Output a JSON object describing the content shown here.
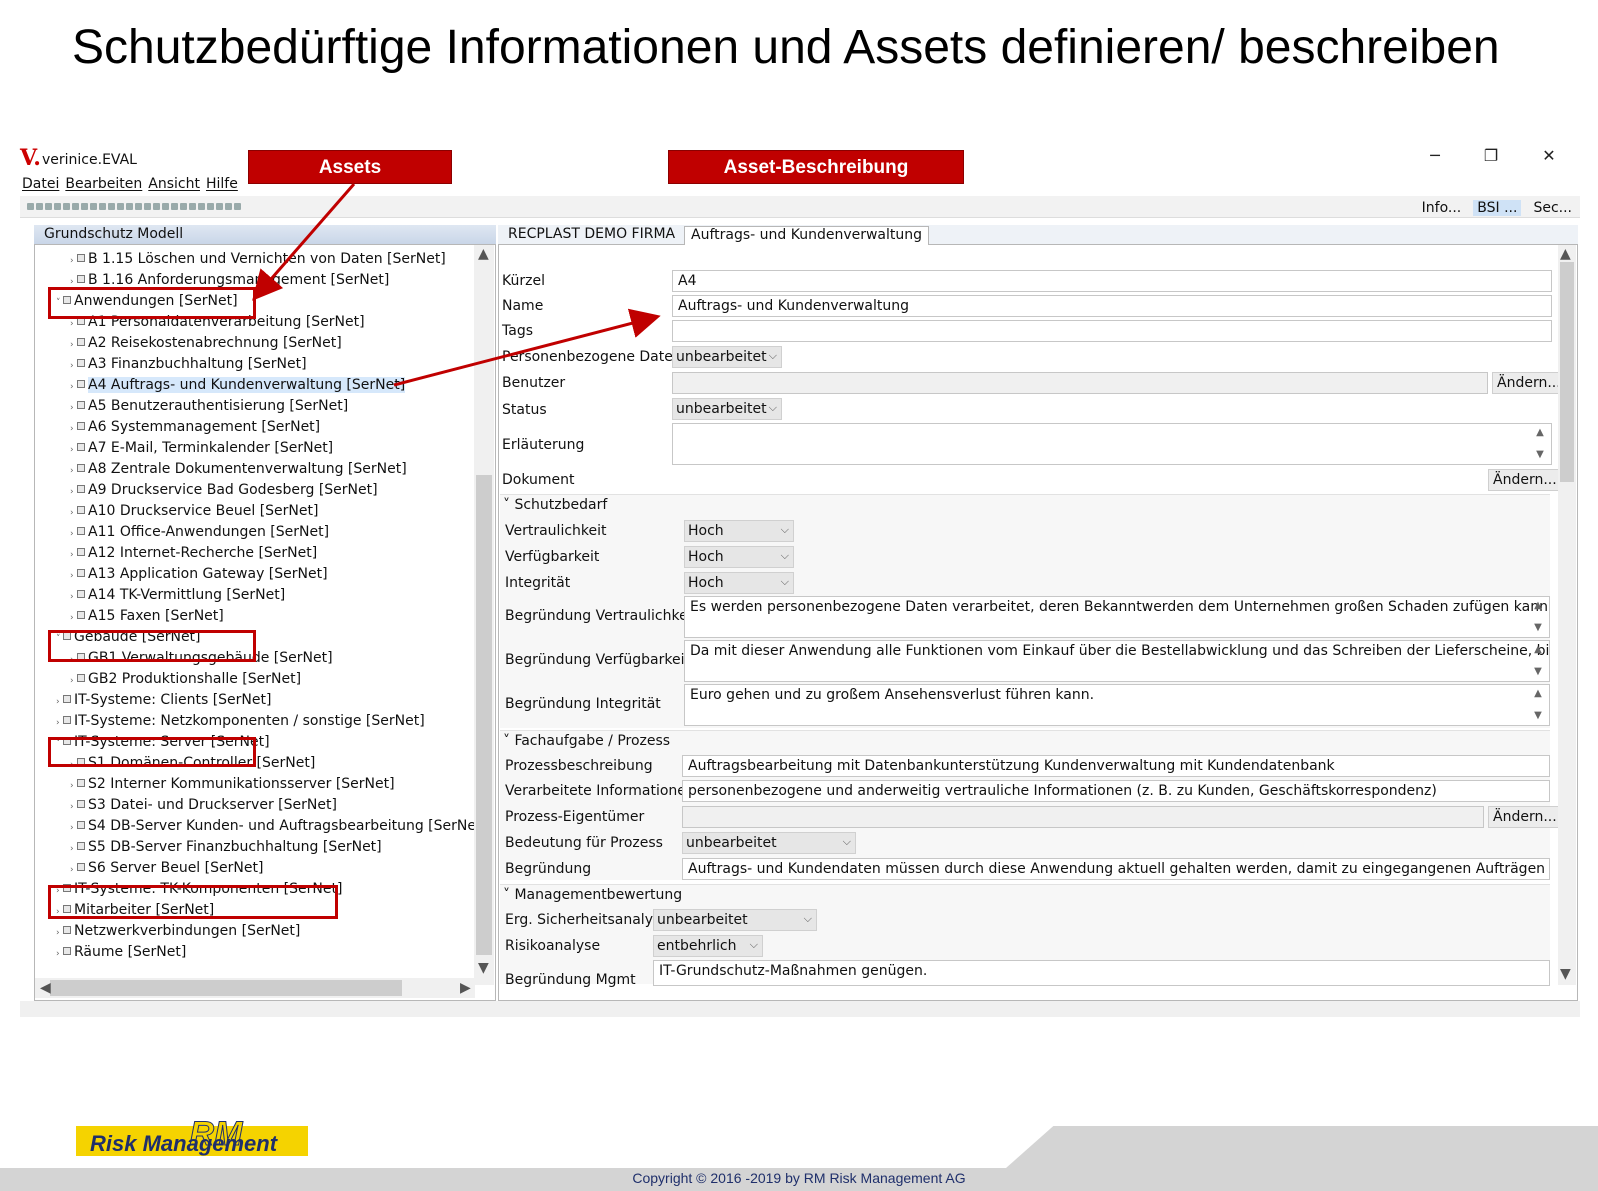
{
  "slide": {
    "title": "Schutzbedürftige Informationen und Assets definieren/ beschreiben",
    "label_assets": "Assets",
    "label_beschreibung": "Asset-Beschreibung",
    "copyright": "Copyright © 2016 -2019 by RM Risk Management AG",
    "logo_text": "Risk Management",
    "logo_mark": "RM"
  },
  "app": {
    "logo": "V.",
    "title": "verinice.EVAL",
    "menu": [
      "Datei",
      "Bearbeiten",
      "Ansicht",
      "Hilfe"
    ],
    "window_controls": {
      "minimize": "─",
      "restore": "❐",
      "close": "✕"
    },
    "perspectives": [
      {
        "label": "Info...",
        "active": false
      },
      {
        "label": "BSI ...",
        "active": true
      },
      {
        "label": "Sec...",
        "active": false
      }
    ]
  },
  "tree": {
    "title": "Grundschutz Modell",
    "items": [
      {
        "label": "B 1.15 Löschen und Vernichten von Daten [SerNet]",
        "level": 1
      },
      {
        "label": "B 1.16 Anforderungsmanagement [SerNet]",
        "level": 1
      },
      {
        "label": "Anwendungen [SerNet]",
        "level": 0,
        "expanded": true
      },
      {
        "label": "A1 Personaldatenverarbeitung [SerNet]",
        "level": 1
      },
      {
        "label": "A2 Reisekostenabrechnung [SerNet]",
        "level": 1
      },
      {
        "label": "A3 Finanzbuchhaltung [SerNet]",
        "level": 1
      },
      {
        "label": "A4 Auftrags- und Kundenverwaltung [SerNet]",
        "level": 1,
        "selected": true
      },
      {
        "label": "A5 Benutzerauthentisierung [SerNet]",
        "level": 1
      },
      {
        "label": "A6 Systemmanagement [SerNet]",
        "level": 1
      },
      {
        "label": "A7 E-Mail, Terminkalender [SerNet]",
        "level": 1
      },
      {
        "label": "A8 Zentrale Dokumentenverwaltung [SerNet]",
        "level": 1
      },
      {
        "label": "A9 Druckservice Bad Godesberg [SerNet]",
        "level": 1
      },
      {
        "label": "A10 Druckservice Beuel [SerNet]",
        "level": 1
      },
      {
        "label": "A11 Office-Anwendungen [SerNet]",
        "level": 1
      },
      {
        "label": "A12 Internet-Recherche [SerNet]",
        "level": 1
      },
      {
        "label": "A13 Application Gateway [SerNet]",
        "level": 1
      },
      {
        "label": "A14 TK-Vermittlung [SerNet]",
        "level": 1
      },
      {
        "label": "A15 Faxen [SerNet]",
        "level": 1
      },
      {
        "label": "Gebäude [SerNet]",
        "level": 0,
        "expanded": true
      },
      {
        "label": "GB1 Verwaltungsgebäude [SerNet]",
        "level": 1
      },
      {
        "label": "GB2 Produktionshalle [SerNet]",
        "level": 1
      },
      {
        "label": "IT-Systeme: Clients [SerNet]",
        "level": 0
      },
      {
        "label": "IT-Systeme: Netzkomponenten / sonstige [SerNet]",
        "level": 0
      },
      {
        "label": "IT-Systeme: Server [SerNet]",
        "level": 0,
        "expanded": true
      },
      {
        "label": "S1 Domänen-Controller [SerNet]",
        "level": 1
      },
      {
        "label": "S2 Interner Kommunikationsserver [SerNet]",
        "level": 1
      },
      {
        "label": "S3 Datei- und Druckserver [SerNet]",
        "level": 1
      },
      {
        "label": "S4 DB-Server Kunden- und Auftragsbearbeitung [SerNet]",
        "level": 1
      },
      {
        "label": "S5 DB-Server Finanzbuchhaltung [SerNet]",
        "level": 1
      },
      {
        "label": "S6 Server Beuel [SerNet]",
        "level": 1
      },
      {
        "label": "IT-Systeme: TK-Komponenten [SerNet]",
        "level": 0
      },
      {
        "label": "Mitarbeiter [SerNet]",
        "level": 0
      },
      {
        "label": "Netzwerkverbindungen [SerNet]",
        "level": 0
      },
      {
        "label": "Räume [SerNet]",
        "level": 0
      }
    ]
  },
  "editor": {
    "tabs": [
      "RECPLAST DEMO FIRMA",
      "Auftrags- und Kundenverwaltung"
    ],
    "change_button": "Ändern...",
    "fields": {
      "kuerzel_label": "Kürzel",
      "kuerzel_value": "A4",
      "name_label": "Name",
      "name_value": "Auftrags- und Kundenverwaltung",
      "tags_label": "Tags",
      "tags_value": "",
      "personenbezogen_label": "Personenbezogene Daten",
      "personenbezogen_value": "unbearbeitet",
      "benutzer_label": "Benutzer",
      "benutzer_value": "",
      "status_label": "Status",
      "status_value": "unbearbeitet",
      "erlaeuterung_label": "Erläuterung",
      "erlaeuterung_value": "",
      "dokument_label": "Dokument"
    },
    "schutzbedarf": {
      "title": "Schutzbedarf",
      "vertraulichkeit_label": "Vertraulichkeit",
      "vertraulichkeit_value": "Hoch",
      "verfuegbarkeit_label": "Verfügbarkeit",
      "verfuegbarkeit_value": "Hoch",
      "integritaet_label": "Integrität",
      "integritaet_value": "Hoch",
      "begr_vertraulichkeit_label": "Begründung Vertraulichkeit",
      "begr_vertraulichkeit_value": "Es werden personenbezogene Daten verarbeitet, deren Bekanntwerden dem Unternehmen großen Schaden zufügen kann (z. B.",
      "begr_verfuegbarkeit_label": "Begründung Verfügbarkeit",
      "begr_verfuegbarkeit_value": "Da mit dieser Anwendung alle Funktionen vom Einkauf über die Bestellabwicklung und das Schreiben der Lieferscheine, bis hin",
      "begr_integritaet_label": "Begründung Integrität",
      "begr_integritaet_value": "Euro gehen und zu großem Ansehensverlust führen kann."
    },
    "fachaufgabe": {
      "title": "Fachaufgabe / Prozess",
      "prozessbeschreibung_label": "Prozessbeschreibung",
      "prozessbeschreibung_value": "Auftragsbearbeitung mit Datenbankunterstützung Kundenverwaltung mit Kundendatenbank",
      "verarbeitete_label": "Verarbeitete Informationen",
      "verarbeitete_value": "personenbezogene und anderweitig vertrauliche Informationen (z. B. zu Kunden, Geschäftskorrespondenz)",
      "eigentuemer_label": "Prozess-Eigentümer",
      "eigentuemer_value": "",
      "bedeutung_label": "Bedeutung für Prozess",
      "bedeutung_value": "unbearbeitet",
      "begruendung_label": "Begründung",
      "begruendung_value": "Auftrags- und Kundendaten müssen durch diese Anwendung aktuell gehalten werden, damit zu eingegangenen Aufträgen zeitnah Be"
    },
    "management": {
      "title": "Managementbewertung",
      "sicherheitsanalyse_label": "Erg. Sicherheitsanalyse",
      "sicherheitsanalyse_value": "unbearbeitet",
      "risikoanalyse_label": "Risikoanalyse",
      "risikoanalyse_value": "entbehrlich",
      "begr_mgmt_label": "Begründung Mgmt",
      "begr_mgmt_value": "IT-Grundschutz-Maßnahmen genügen."
    }
  }
}
